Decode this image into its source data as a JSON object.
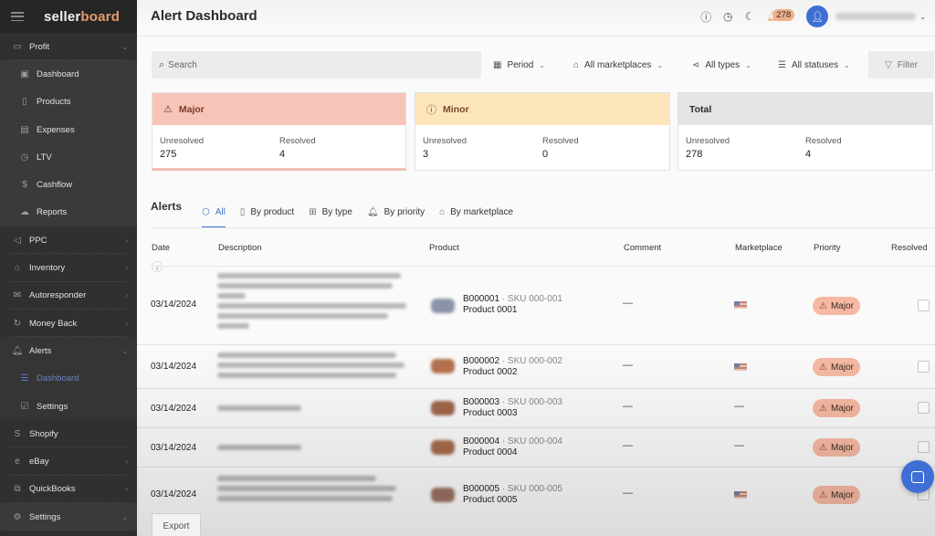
{
  "app": {
    "logo_part1": "seller",
    "logo_part2": "board",
    "page_title": "Alert Dashboard"
  },
  "sidebar": {
    "items": [
      {
        "label": "Profit",
        "icon": "monitor-icon",
        "expanded": true
      },
      {
        "label": "Dashboard",
        "icon": "layout-icon"
      },
      {
        "label": "Products",
        "icon": "clipboard-icon"
      },
      {
        "label": "Expenses",
        "icon": "card-icon"
      },
      {
        "label": "LTV",
        "icon": "clock-icon"
      },
      {
        "label": "Cashflow",
        "icon": "dollar-icon"
      },
      {
        "label": "Reports",
        "icon": "cloud-download-icon"
      },
      {
        "label": "PPC",
        "icon": "megaphone-icon"
      },
      {
        "label": "Inventory",
        "icon": "store-icon"
      },
      {
        "label": "Autoresponder",
        "icon": "mail-icon"
      },
      {
        "label": "Money Back",
        "icon": "refresh-icon"
      },
      {
        "label": "Alerts",
        "icon": "bell-icon",
        "expanded": true
      },
      {
        "label": "Dashboard",
        "icon": "filter-lines-icon",
        "active": true
      },
      {
        "label": "Settings",
        "icon": "checkbox-edit-icon"
      },
      {
        "label": "Shopify",
        "icon": "shopify-icon"
      },
      {
        "label": "eBay",
        "icon": "ebay-icon"
      },
      {
        "label": "QuickBooks",
        "icon": "copy-icon"
      },
      {
        "label": "Settings",
        "icon": "gear-icon"
      }
    ]
  },
  "header": {
    "notification_count": "278",
    "colors": {
      "accent": "#3f6fd4",
      "badge": "#ecb08a"
    }
  },
  "filters": {
    "search_placeholder": "Search",
    "period": "Period",
    "marketplaces": "All marketplaces",
    "types": "All types",
    "statuses": "All statuses",
    "filter_button": "Filter"
  },
  "summary": {
    "major": {
      "title": "Major",
      "unresolved_label": "Unresolved",
      "unresolved": "275",
      "resolved_label": "Resolved",
      "resolved": "4",
      "color": "#f7c5b8"
    },
    "minor": {
      "title": "Minor",
      "unresolved_label": "Unresolved",
      "unresolved": "3",
      "resolved_label": "Resolved",
      "resolved": "0",
      "color": "#fde5bb"
    },
    "total": {
      "title": "Total",
      "unresolved_label": "Unresolved",
      "unresolved": "278",
      "resolved_label": "Resolved",
      "resolved": "4",
      "color": "#e4e4e4"
    }
  },
  "alerts": {
    "title": "Alerts",
    "tabs": [
      {
        "label": "All",
        "active": true
      },
      {
        "label": "By product"
      },
      {
        "label": "By type"
      },
      {
        "label": "By priority"
      },
      {
        "label": "By marketplace"
      }
    ],
    "columns": [
      "Date",
      "Description",
      "Product",
      "Comment",
      "Marketplace",
      "Priority",
      "Resolved"
    ],
    "rows": [
      {
        "date": "03/14/2024",
        "asin": "B000001",
        "sku": "· SKU 000-001",
        "product": "Product 0001",
        "comment": "—",
        "marketplace": "US",
        "priority": "Major",
        "resolved": false
      },
      {
        "date": "03/14/2024",
        "asin": "B000002",
        "sku": "· SKU 000-002",
        "product": "Product 0002",
        "comment": "—",
        "marketplace": "US",
        "priority": "Major",
        "resolved": false
      },
      {
        "date": "03/14/2024",
        "asin": "B000003",
        "sku": "· SKU 000-003",
        "product": "Product 0003",
        "comment": "—",
        "marketplace": "—",
        "priority": "Major",
        "resolved": false
      },
      {
        "date": "03/14/2024",
        "asin": "B000004",
        "sku": "· SKU 000-004",
        "product": "Product 0004",
        "comment": "—",
        "marketplace": "—",
        "priority": "Major",
        "resolved": false
      },
      {
        "date": "03/14/2024",
        "asin": "B000005",
        "sku": "· SKU 000-005",
        "product": "Product 0005",
        "comment": "—",
        "marketplace": "US",
        "priority": "Major",
        "resolved": false
      }
    ],
    "export_label": "Export"
  }
}
